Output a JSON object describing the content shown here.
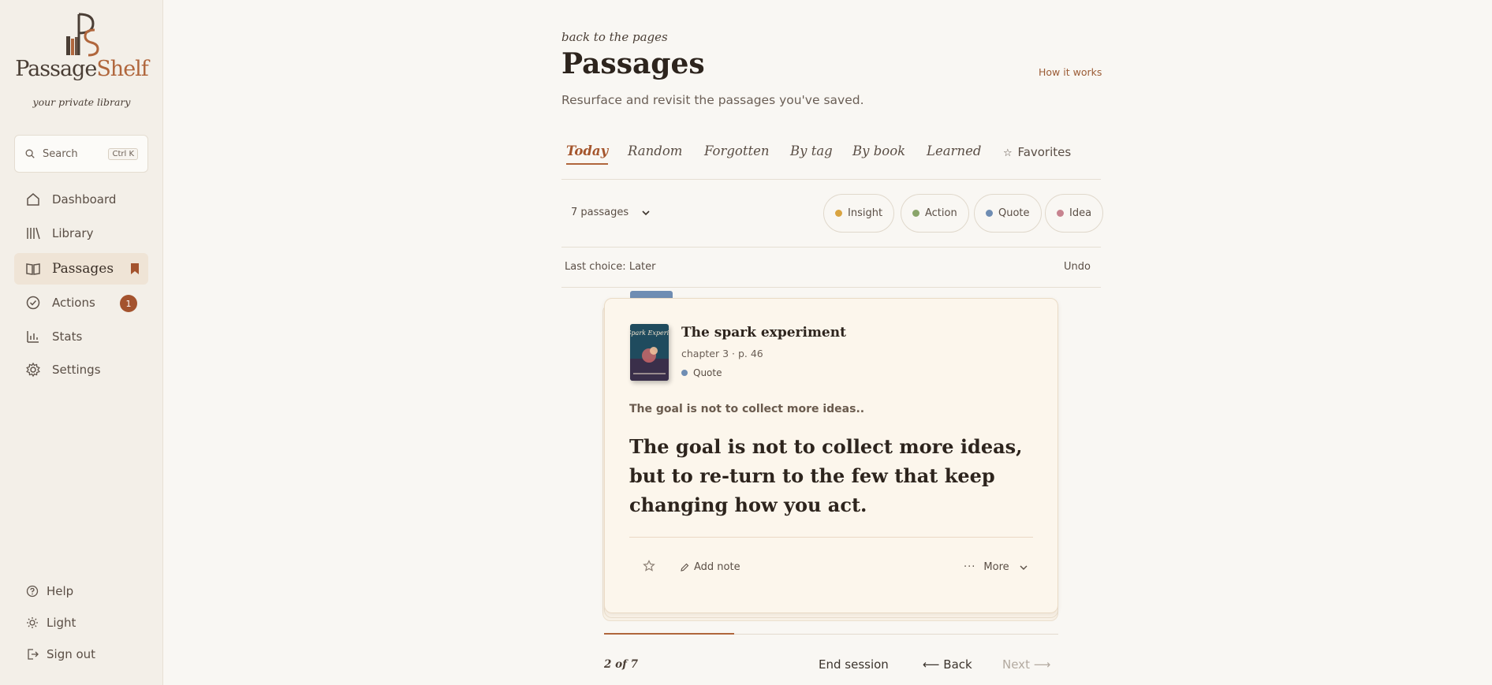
{
  "app": {
    "logo_prefix": "Passage",
    "logo_accent": "Shelf",
    "tagline": "your private library"
  },
  "sidebar": {
    "search": {
      "placeholder": "Search",
      "shortcut": "Ctrl K"
    },
    "items": [
      {
        "label": "Dashboard",
        "icon": "home-icon"
      },
      {
        "label": "Library",
        "icon": "books-icon"
      },
      {
        "label": "Passages",
        "icon": "open-book-icon",
        "active": true
      },
      {
        "label": "Actions",
        "icon": "check-circle-icon",
        "badge": "1"
      },
      {
        "label": "Stats",
        "icon": "bar-chart-icon"
      },
      {
        "label": "Settings",
        "icon": "gear-icon"
      }
    ],
    "footer": [
      {
        "label": "Help",
        "icon": "help-icon"
      },
      {
        "label": "Light",
        "icon": "sun-icon"
      },
      {
        "label": "Sign out",
        "icon": "sign-out-icon"
      }
    ]
  },
  "header": {
    "back_link": "back to the pages",
    "title": "Passages",
    "how_it_works": "How it works",
    "subtitle": "Resurface and revisit the passages you've saved."
  },
  "tabs": [
    {
      "label": "Today",
      "active": true
    },
    {
      "label": "Random"
    },
    {
      "label": "Forgotten"
    },
    {
      "label": "By tag"
    },
    {
      "label": "By book"
    },
    {
      "label": "Learned"
    },
    {
      "label": "Favorites",
      "icon": "star-icon"
    }
  ],
  "filters": {
    "count_label": "7 passages",
    "chips": [
      {
        "label": "Insight",
        "color": "#d9a441"
      },
      {
        "label": "Action",
        "color": "#8aa56a"
      },
      {
        "label": "Quote",
        "color": "#6f8db3"
      },
      {
        "label": "Idea",
        "color": "#c7838f"
      }
    ]
  },
  "choice": {
    "label": "Last choice: Later",
    "undo": "Undo"
  },
  "card": {
    "book_title": "The spark experiment",
    "meta": "chapter 3 · p. 46",
    "tag": {
      "label": "Quote",
      "color": "#6f8db3"
    },
    "cover_title": "The Spark Experiment",
    "excerpt": "The goal is not to collect more ideas..",
    "quote": "The goal is not to collect more ideas, but to re-turn to the few that keep changing how you act.",
    "add_note": "Add note",
    "more": "More"
  },
  "session": {
    "progress": 0.2857,
    "counter": "2 of 7",
    "end_session": "End session",
    "back": "⟵ Back",
    "next": "Next ⟶"
  },
  "colors": {
    "accent": "#b0663c",
    "badge": "#a4532e",
    "background": "#f9f7f3"
  }
}
